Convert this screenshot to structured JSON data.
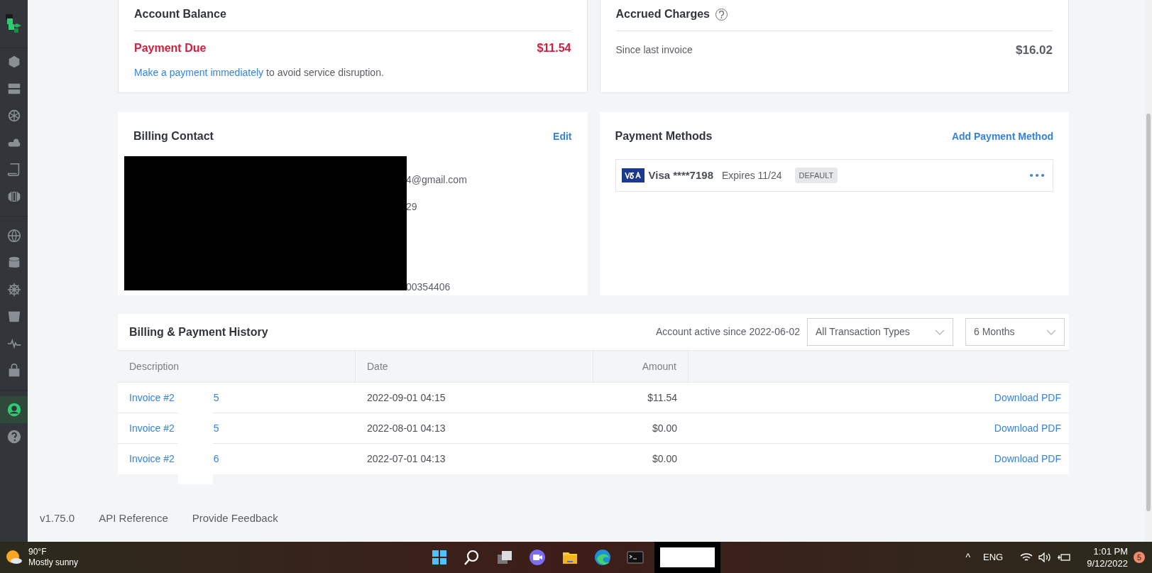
{
  "sidebar": {
    "items": [
      {
        "selected": false
      },
      {
        "selected": false
      },
      {
        "selected": false
      },
      {
        "selected": false
      },
      {
        "selected": false
      },
      {
        "selected": false
      },
      {
        "selected": false
      },
      {
        "selected": false
      },
      {
        "selected": false
      },
      {
        "selected": false
      },
      {
        "selected": false
      },
      {
        "selected": false
      },
      {
        "selected": true
      },
      {
        "selected": false
      }
    ]
  },
  "account_balance": {
    "title": "Account Balance",
    "status": "Payment Due",
    "amount": "$11.54",
    "link": "Make a payment immediately",
    "message": "to avoid service disruption."
  },
  "accrued_charges": {
    "title": "Accrued Charges",
    "label": "Since last invoice",
    "amount": "$16.02"
  },
  "billing_contact": {
    "title": "Billing Contact",
    "edit": "Edit",
    "lines": [
      "4@gmail.com",
      "29",
      "00354406"
    ]
  },
  "payment_methods": {
    "title": "Payment Methods",
    "add": "Add Payment Method",
    "cards": [
      {
        "name": "Visa ****7198",
        "expires": "Expires 11/24",
        "badge": "DEFAULT"
      }
    ]
  },
  "history": {
    "title": "Billing & Payment History",
    "active_since": "Account active since 2022-06-02",
    "filters": [
      {
        "value": "All Transaction Types"
      },
      {
        "value": "6 Months"
      }
    ],
    "columns": [
      "Description",
      "Date",
      "Amount"
    ],
    "rows": [
      {
        "description": "Invoice #2",
        "description_tail": "5",
        "date": "2022-09-01 04:15",
        "amount": "$11.54",
        "action": "Download PDF"
      },
      {
        "description": "Invoice #2",
        "description_tail": "5",
        "date": "2022-08-01 04:13",
        "amount": "$0.00",
        "action": "Download PDF"
      },
      {
        "description": "Invoice #2",
        "description_tail": "6",
        "date": "2022-07-01 04:13",
        "amount": "$0.00",
        "action": "Download PDF"
      }
    ]
  },
  "footer": [
    "v1.75.0",
    "API Reference",
    "Provide Feedback"
  ],
  "taskbar": {
    "temperature": "90°F",
    "weather": "Mostly sunny",
    "tray_caret": "^",
    "language": "ENG",
    "time": "1:01 PM",
    "date": "9/12/2022",
    "notifications": "5"
  }
}
